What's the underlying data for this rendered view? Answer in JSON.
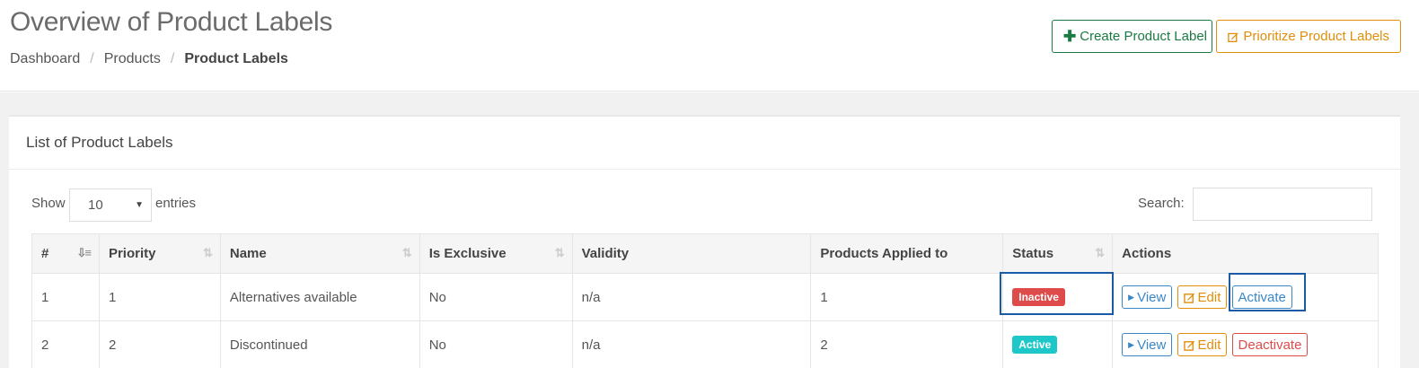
{
  "header": {
    "title": "Overview of Product Labels",
    "breadcrumb": [
      "Dashboard",
      "Products",
      "Product Labels"
    ],
    "create_label": "Create Product Label",
    "prioritize_label": "Prioritize Product Labels"
  },
  "panel": {
    "title": "List of Product Labels",
    "show_label": "Show",
    "entries_label": "entries",
    "page_length": "10",
    "search_label": "Search:",
    "search_value": ""
  },
  "table": {
    "columns": [
      "#",
      "Priority",
      "Name",
      "Is Exclusive",
      "Validity",
      "Products Applied to",
      "Status",
      "Actions"
    ],
    "rows": [
      {
        "num": "1",
        "priority": "1",
        "name": "Alternatives available",
        "exclusive": "No",
        "validity": "n/a",
        "products": "1",
        "status": "Inactive",
        "view": "View",
        "edit": "Edit",
        "toggle": "Activate"
      },
      {
        "num": "2",
        "priority": "2",
        "name": "Discontinued",
        "exclusive": "No",
        "validity": "n/a",
        "products": "2",
        "status": "Active",
        "view": "View",
        "edit": "Edit",
        "toggle": "Deactivate"
      }
    ]
  },
  "colors": {
    "create_btn": "#1b7a43",
    "prioritize_btn": "#e08e0b",
    "inactive_badge": "#dd4b4b",
    "active_badge": "#1fc8c8",
    "view_btn": "#3a87c8",
    "highlight": "#1a5aa6"
  },
  "icons": {
    "create": "plus-icon",
    "prioritize": "edit-icon",
    "view": "caret-right-icon",
    "edit": "edit-icon",
    "sort": "sort-icon",
    "select": "chevron-down-icon"
  }
}
